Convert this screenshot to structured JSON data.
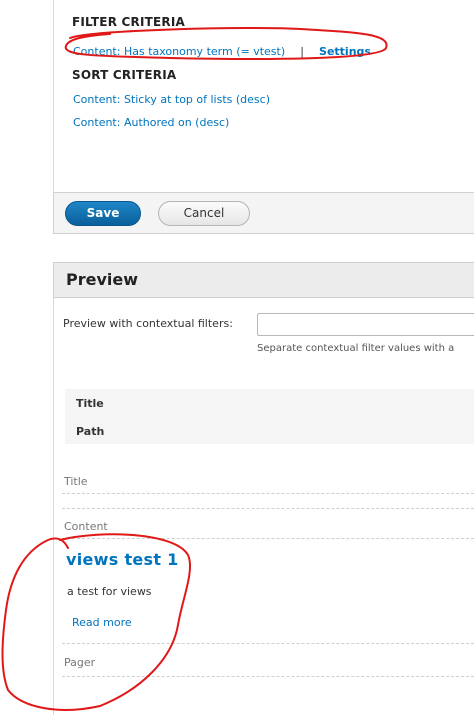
{
  "filter": {
    "heading": "FILTER CRITERIA",
    "items": [
      {
        "label": "Content: Has taxonomy term (= vtest)",
        "separator": "|",
        "settings_label": "Settings"
      }
    ]
  },
  "sort": {
    "heading": "SORT CRITERIA",
    "items": [
      {
        "label": "Content: Sticky at top of lists (desc)"
      },
      {
        "label": "Content: Authored on (desc)"
      }
    ]
  },
  "actions": {
    "save_label": "Save",
    "cancel_label": "Cancel"
  },
  "preview": {
    "title": "Preview",
    "contextual_label": "Preview with contextual filters:",
    "contextual_value": "",
    "contextual_desc": "Separate contextual filter values with a",
    "info_rows": [
      "Title",
      "Path"
    ],
    "fields": {
      "title_label": "Title",
      "content_label": "Content",
      "pager_label": "Pager"
    },
    "node": {
      "title": "views test 1",
      "body": "a test for views",
      "read_more": "Read more"
    }
  },
  "colors": {
    "link": "#0074bd",
    "annotation": "#e01818",
    "save_button": "#0a6fb3"
  }
}
